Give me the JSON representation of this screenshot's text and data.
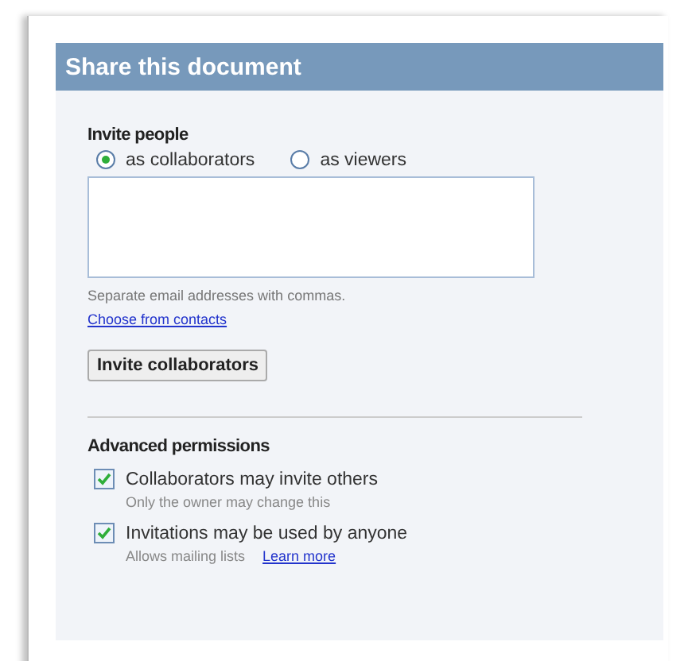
{
  "dialog": {
    "title": "Share this document"
  },
  "invite": {
    "heading": "Invite people",
    "roles": [
      {
        "label": "as collaborators",
        "selected": true
      },
      {
        "label": "as viewers",
        "selected": false
      }
    ],
    "hint": "Separate email addresses with commas.",
    "contacts_link": "Choose from contacts",
    "button": "Invite collaborators"
  },
  "advanced": {
    "heading": "Advanced permissions",
    "options": [
      {
        "label": "Collaborators may invite others",
        "note": "Only the owner may change this",
        "checked": true
      },
      {
        "label": "Invitations may be used by anyone",
        "note": "Allows mailing lists",
        "link": "Learn more",
        "checked": true
      }
    ]
  }
}
